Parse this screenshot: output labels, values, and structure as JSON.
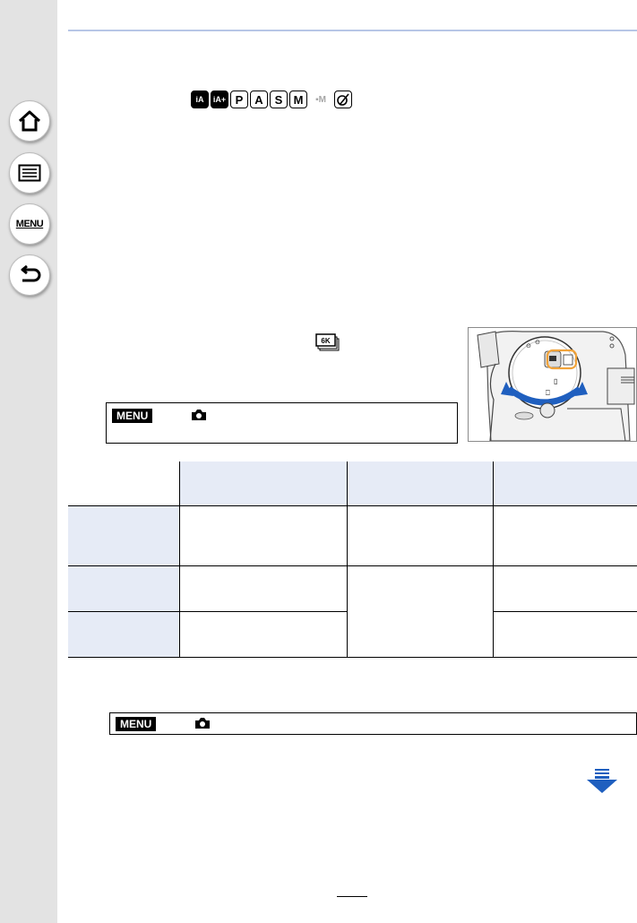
{
  "sidebar": {
    "home_icon": "home-icon",
    "toc_icon": "list-icon",
    "menu_label": "MENU",
    "back_icon": "back-arrow-icon"
  },
  "modes": {
    "items": [
      "iA",
      "iA+",
      "P",
      "A",
      "S",
      "M",
      "film-M",
      "creative"
    ],
    "p": "P",
    "a": "A",
    "s": "S",
    "m": "M",
    "movie": "▪M"
  },
  "menu_path_1": {
    "menu_tag": "MENU",
    "camera_icon": "camera-icon"
  },
  "menu_path_2": {
    "menu_tag": "MENU",
    "camera_icon": "camera-icon"
  },
  "colors": {
    "sidebar_bg": "#e3e3e3",
    "table_header_bg": "#e6ebf6",
    "rule": "#b7c6e6",
    "highlight": "#f1a33a",
    "arrow": "#1f5fbf"
  },
  "icons": {
    "drive_mode_icon": "6k-photo-icon",
    "next_page_icon": "down-arrow-icon"
  }
}
